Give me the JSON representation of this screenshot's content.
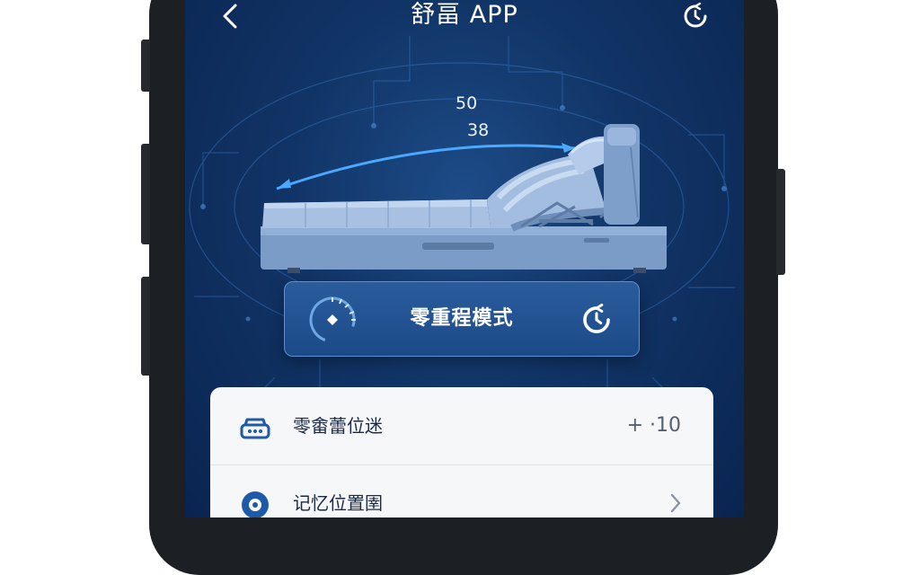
{
  "header": {
    "title": "舒畐 APP",
    "back_icon": "chevron-left-icon",
    "timer_icon": "timer-icon"
  },
  "bed_diagram": {
    "angle_top": "50",
    "angle_bottom": "38"
  },
  "mode_card": {
    "label": "零重程模式",
    "gauge_icon": "gauge-icon",
    "timer_icon": "timer-icon"
  },
  "settings": {
    "rows": [
      {
        "label": "零畬蕾位迷",
        "value": "+ ·10",
        "icon": "bed-remote-icon"
      },
      {
        "label": "记忆位置圉",
        "icon": "memory-icon",
        "chevron": "chevron-right-icon"
      }
    ]
  },
  "colors": {
    "screen_bg": "#113466",
    "accent": "#2a5c9c",
    "icon_blue": "#1e5aa8",
    "panel_bg": "#f6f7f9"
  }
}
